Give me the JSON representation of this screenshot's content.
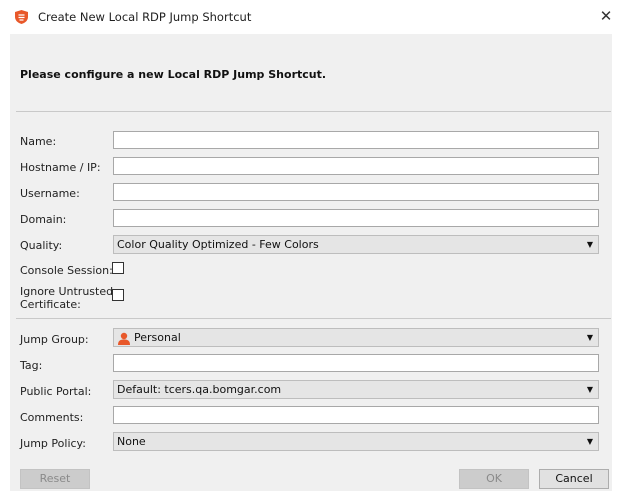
{
  "window": {
    "title": "Create New Local RDP Jump Shortcut",
    "close_glyph": "✕",
    "icon": "shield-icon"
  },
  "dialog": {
    "heading": "Please configure a new Local RDP Jump Shortcut."
  },
  "fields": {
    "name": {
      "label": "Name:",
      "value": ""
    },
    "hostname": {
      "label": "Hostname / IP:",
      "value": ""
    },
    "username": {
      "label": "Username:",
      "value": ""
    },
    "domain": {
      "label": "Domain:",
      "value": ""
    },
    "quality": {
      "label": "Quality:",
      "value": "Color Quality Optimized - Few Colors"
    },
    "console_session": {
      "label": "Console Session:",
      "checked": false
    },
    "ignore_cert": {
      "label_line1": "Ignore Untrusted",
      "label_line2": "Certificate:",
      "checked": false
    },
    "jump_group": {
      "label": "Jump Group:",
      "value": "Personal",
      "icon": "person-icon"
    },
    "tag": {
      "label": "Tag:",
      "value": ""
    },
    "public_portal": {
      "label": "Public Portal:",
      "value": "Default: tcers.qa.bomgar.com"
    },
    "comments": {
      "label": "Comments:",
      "value": ""
    },
    "jump_policy": {
      "label": "Jump Policy:",
      "value": "None"
    }
  },
  "buttons": {
    "reset": "Reset",
    "ok": "OK",
    "cancel": "Cancel"
  },
  "colors": {
    "panel_bg": "#f0f0f0",
    "icon_orange": "#e8582a"
  }
}
